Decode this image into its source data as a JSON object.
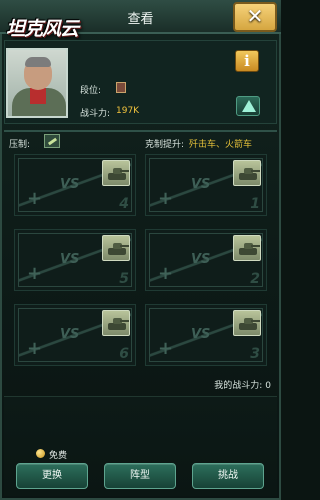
{
  "window": {
    "title": "查看",
    "logo_text": "坦克风云",
    "close_symbol": "✕"
  },
  "profile": {
    "rank_label": "段位:",
    "power_label": "战斗力:",
    "power_value": "197K",
    "info_symbol": "i"
  },
  "matchup": {
    "suppress_label": "压制:",
    "counter_label": "克制提升:",
    "counter_value": "歼击车、火箭车"
  },
  "slots": [
    {
      "vs": "VS",
      "number": "4"
    },
    {
      "vs": "VS",
      "number": "1"
    },
    {
      "vs": "VS",
      "number": "5"
    },
    {
      "vs": "VS",
      "number": "2"
    },
    {
      "vs": "VS",
      "number": "6"
    },
    {
      "vs": "VS",
      "number": "3"
    }
  ],
  "summary": {
    "my_power_label": "我的战斗力:",
    "my_power_value": "0"
  },
  "footer": {
    "free_label": "免费",
    "buttons": {
      "swap": "更换",
      "formation": "阵型",
      "challenge": "挑战"
    }
  },
  "colors": {
    "accent_gold": "#f0c23d",
    "counter_text": "#e6c23a",
    "button_green": "#2d6f5c"
  }
}
